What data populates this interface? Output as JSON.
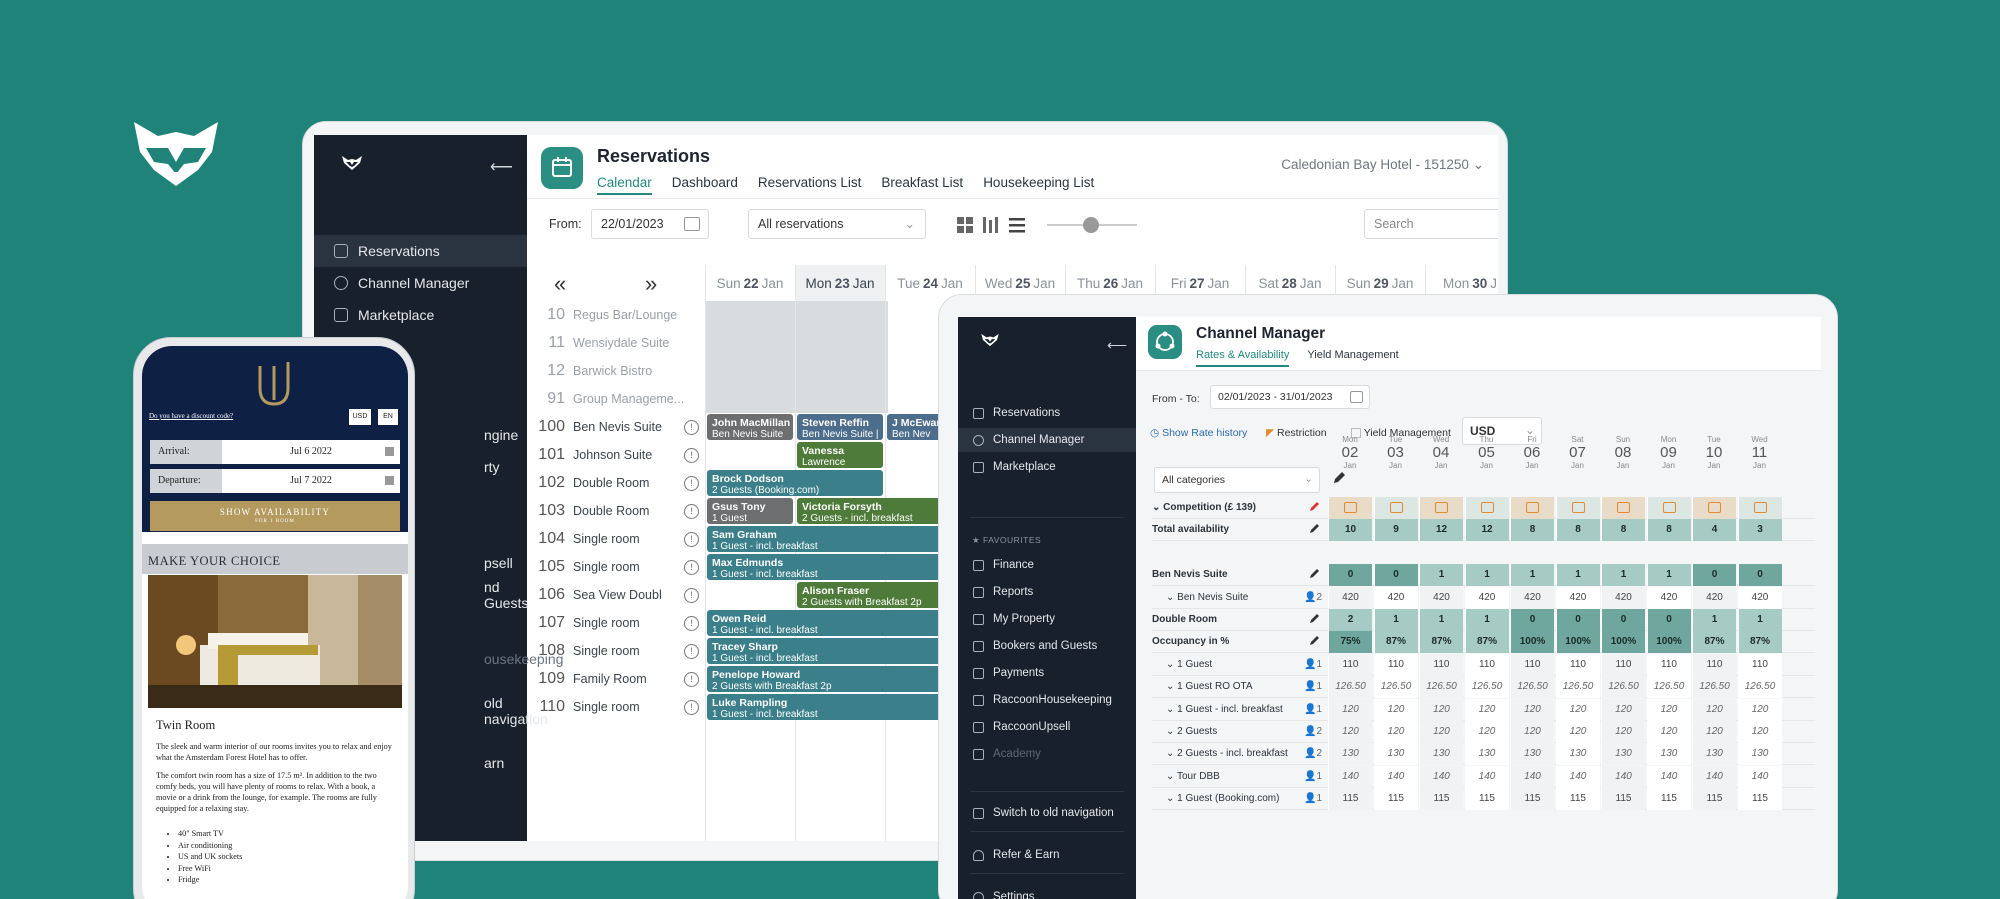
{
  "brand_icon": "raccoon-logo",
  "reservations": {
    "sidebar": {
      "back_icon": "⟵",
      "items": [
        {
          "label": "Reservations",
          "icon": "calendar-icon",
          "active": true
        },
        {
          "label": "Channel Manager",
          "icon": "channel-icon"
        },
        {
          "label": "Marketplace",
          "icon": "marketplace-icon"
        }
      ],
      "partial_items": [
        "ngine",
        "rty",
        "psell",
        "nd Guests",
        "ousekeeping",
        "old navigation",
        "arn"
      ]
    },
    "title": "Reservations",
    "tabs": [
      "Calendar",
      "Dashboard",
      "Reservations List",
      "Breakfast List",
      "Housekeeping List"
    ],
    "hotel": "Caledonian Bay Hotel - 151250",
    "filters": {
      "from_label": "From:",
      "from_value": "22/01/2023",
      "select_value": "All reservations",
      "search_placeholder": "Search"
    },
    "nav_prev": "«",
    "nav_next": "»",
    "days": [
      {
        "dow": "Sun",
        "num": "22",
        "mon": "Jan"
      },
      {
        "dow": "Mon",
        "num": "23",
        "mon": "Jan",
        "today": true
      },
      {
        "dow": "Tue",
        "num": "24",
        "mon": "Jan"
      },
      {
        "dow": "Wed",
        "num": "25",
        "mon": "Jan"
      },
      {
        "dow": "Thu",
        "num": "26",
        "mon": "Jan"
      },
      {
        "dow": "Fri",
        "num": "27",
        "mon": "Jan"
      },
      {
        "dow": "Sat",
        "num": "28",
        "mon": "Jan"
      },
      {
        "dow": "Sun",
        "num": "29",
        "mon": "Jan"
      },
      {
        "dow": "Mon",
        "num": "30",
        "mon": "J"
      }
    ],
    "rooms": [
      {
        "num": "10",
        "name": "Regus Bar/Lounge",
        "light": true
      },
      {
        "num": "11",
        "name": "Wensiydale Suite",
        "light": true
      },
      {
        "num": "12",
        "name": "Barwick Bistro",
        "light": true
      },
      {
        "num": "91",
        "name": "Group Manageme...",
        "light": true
      },
      {
        "num": "100",
        "name": "Ben Nevis Suite"
      },
      {
        "num": "101",
        "name": "Johnson Suite"
      },
      {
        "num": "102",
        "name": "Double Room"
      },
      {
        "num": "103",
        "name": "Double Room"
      },
      {
        "num": "104",
        "name": "Single room"
      },
      {
        "num": "105",
        "name": "Single room"
      },
      {
        "num": "106",
        "name": "Sea View Doubl"
      },
      {
        "num": "107",
        "name": "Single room"
      },
      {
        "num": "108",
        "name": "Single room"
      },
      {
        "num": "109",
        "name": "Family Room"
      },
      {
        "num": "110",
        "name": "Single room"
      }
    ],
    "bookings": [
      {
        "name": "John MacMillan",
        "detail": "Ben Nevis Suite",
        "row": 4,
        "col": 0,
        "span": 1,
        "color": "gray"
      },
      {
        "name": "Steven Reffin",
        "detail": "Ben Nevis Suite |",
        "row": 4,
        "col": 1,
        "span": 1,
        "color": "navy"
      },
      {
        "name": "J McEwan",
        "detail": "Ben Nev",
        "row": 4,
        "col": 2,
        "span": 1,
        "color": "navy"
      },
      {
        "name": "Vanessa",
        "detail": "Lawrence",
        "row": 5,
        "col": 1,
        "span": 1,
        "color": "green"
      },
      {
        "name": "Brock Dodson",
        "detail": "2 Guests (Booking.com)",
        "row": 6,
        "col": 0,
        "span": 2,
        "color": "teal"
      },
      {
        "name": "Gsus Tony",
        "detail": "1 Guest",
        "row": 7,
        "col": 0,
        "span": 1,
        "color": "gray"
      },
      {
        "name": "Victoria Forsyth",
        "detail": "2 Guests - incl. breakfast",
        "row": 7,
        "col": 1,
        "span": 2,
        "color": "green"
      },
      {
        "name": "Sam Graham",
        "detail": "1 Guest - incl. breakfast",
        "row": 8,
        "col": 0,
        "span": 3,
        "color": "teal"
      },
      {
        "name": "Max Edmunds",
        "detail": "1 Guest - incl. breakfast",
        "row": 9,
        "col": 0,
        "span": 3,
        "color": "teal"
      },
      {
        "name": "Alison Fraser",
        "detail": "2 Guests with Breakfast 2p",
        "row": 10,
        "col": 1,
        "span": 2,
        "color": "green"
      },
      {
        "name": "Owen Reid",
        "detail": "1 Guest - incl. breakfast",
        "row": 11,
        "col": 0,
        "span": 3,
        "color": "teal"
      },
      {
        "name": "Tracey Sharp",
        "detail": "1 Guest - incl. breakfast",
        "row": 12,
        "col": 0,
        "span": 3,
        "color": "teal"
      },
      {
        "name": "Penelope Howard",
        "detail": "2 Guests with Breakfast 2p",
        "row": 13,
        "col": 0,
        "span": 3,
        "color": "teal"
      },
      {
        "name": "Luke Rampling",
        "detail": "1 Guest - incl. breakfast",
        "row": 14,
        "col": 0,
        "span": 3,
        "color": "teal"
      }
    ]
  },
  "channel": {
    "sidebar": {
      "items": [
        "Reservations",
        "Channel Manager",
        "Marketplace"
      ],
      "favourites_label": "FAVOURITES",
      "favourites": [
        "Finance",
        "Reports",
        "My Property",
        "Bookers and Guests",
        "Payments",
        "RaccoonHousekeeping",
        "RaccoonUpsell",
        "Academy"
      ],
      "switch": "Switch to old navigation",
      "refer": "Refer & Earn",
      "settings": "Settings"
    },
    "title": "Channel Manager",
    "tabs": [
      "Rates & Availability",
      "Yield Management"
    ],
    "from_to_label": "From - To:",
    "from_to_value": "02/01/2023 - 31/01/2023",
    "show_rate_history": "Show Rate history",
    "restriction": "Restriction",
    "yield_management": "Yield Management",
    "currency": "USD",
    "category_select": "All categories",
    "days": [
      {
        "dow": "Mon",
        "num": "02",
        "mon": "Jan"
      },
      {
        "dow": "Tue",
        "num": "03",
        "mon": "Jan"
      },
      {
        "dow": "Wed",
        "num": "04",
        "mon": "Jan"
      },
      {
        "dow": "Thu",
        "num": "05",
        "mon": "Jan"
      },
      {
        "dow": "Fri",
        "num": "06",
        "mon": "Jan"
      },
      {
        "dow": "Sat",
        "num": "07",
        "mon": "Jan"
      },
      {
        "dow": "Sun",
        "num": "08",
        "mon": "Jan"
      },
      {
        "dow": "Mon",
        "num": "09",
        "mon": "Jan"
      },
      {
        "dow": "Tue",
        "num": "10",
        "mon": "Jan"
      },
      {
        "dow": "Wed",
        "num": "11",
        "mon": "Jan"
      }
    ],
    "rows": [
      {
        "label": "Competition (£ 139)",
        "bold": true,
        "type": "comp"
      },
      {
        "label": "Total availability",
        "bold": true,
        "type": "avail",
        "values": [
          "10",
          "9",
          "12",
          "12",
          "8",
          "8",
          "8",
          "8",
          "4",
          "3"
        ]
      },
      {
        "label": "",
        "type": "gap"
      },
      {
        "label": "Ben Nevis Suite",
        "bold": true,
        "type": "avail",
        "values": [
          "0",
          "0",
          "1",
          "1",
          "1",
          "1",
          "1",
          "1",
          "0",
          "0"
        ]
      },
      {
        "label": "Ben Nevis Suite",
        "guests": "2",
        "values": [
          "420",
          "420",
          "420",
          "420",
          "420",
          "420",
          "420",
          "420",
          "420",
          "420"
        ]
      },
      {
        "label": "Double Room",
        "bold": true,
        "type": "avail",
        "values": [
          "2",
          "1",
          "1",
          "1",
          "0",
          "0",
          "0",
          "0",
          "1",
          "1"
        ]
      },
      {
        "label": "Occupancy in %",
        "bold": true,
        "type": "avail",
        "values": [
          "75%",
          "87%",
          "87%",
          "87%",
          "100%",
          "100%",
          "100%",
          "100%",
          "87%",
          "87%"
        ]
      },
      {
        "label": "1 Guest",
        "guests": "1",
        "values": [
          "110",
          "110",
          "110",
          "110",
          "110",
          "110",
          "110",
          "110",
          "110",
          "110"
        ]
      },
      {
        "label": "1 Guest RO OTA",
        "guests": "1",
        "italic": true,
        "values": [
          "126.50",
          "126.50",
          "126.50",
          "126.50",
          "126.50",
          "126.50",
          "126.50",
          "126.50",
          "126.50",
          "126.50"
        ]
      },
      {
        "label": "1 Guest - incl. breakfast",
        "guests": "1",
        "italic": true,
        "values": [
          "120",
          "120",
          "120",
          "120",
          "120",
          "120",
          "120",
          "120",
          "120",
          "120"
        ]
      },
      {
        "label": "2 Guests",
        "guests": "2",
        "italic": true,
        "values": [
          "120",
          "120",
          "120",
          "120",
          "120",
          "120",
          "120",
          "120",
          "120",
          "120"
        ]
      },
      {
        "label": "2 Guests - incl. breakfast",
        "guests": "2",
        "italic": true,
        "values": [
          "130",
          "130",
          "130",
          "130",
          "130",
          "130",
          "130",
          "130",
          "130",
          "130"
        ]
      },
      {
        "label": "Tour DBB",
        "guests": "1",
        "italic": true,
        "values": [
          "140",
          "140",
          "140",
          "140",
          "140",
          "140",
          "140",
          "140",
          "140",
          "140"
        ]
      },
      {
        "label": "1 Guest (Booking.com)",
        "guests": "1",
        "values": [
          "115",
          "115",
          "115",
          "115",
          "115",
          "115",
          "115",
          "115",
          "115",
          "115"
        ]
      }
    ]
  },
  "phone": {
    "discount": "Do you have a discount code?",
    "currency": "USD",
    "lang": "EN",
    "arrival_label": "Arrival:",
    "arrival_value": "Jul 6 2022",
    "departure_label": "Departure:",
    "departure_value": "Jul 7 2022",
    "button": "SHOW AVAILABILITY",
    "button_sub": "FOR 1 ROOM",
    "section": "MAKE YOUR CHOICE",
    "room_title": "Twin Room",
    "para1": "The sleek and warm interior of our rooms invites you to relax and enjoy what the Amsterdam Forest Hotel has to offer.",
    "para2": "The comfort twin room has a size of 17.5 m². In addition to the two comfy beds, you will have plenty of rooms to relax. With a book, a movie or a drink from the lounge, for example. The rooms are fully equipped for a relaxing stay.",
    "amenities": [
      "40\" Smart TV",
      "Air conditioning",
      "US and UK sockets",
      "Free WiFi",
      "Fridge"
    ]
  }
}
